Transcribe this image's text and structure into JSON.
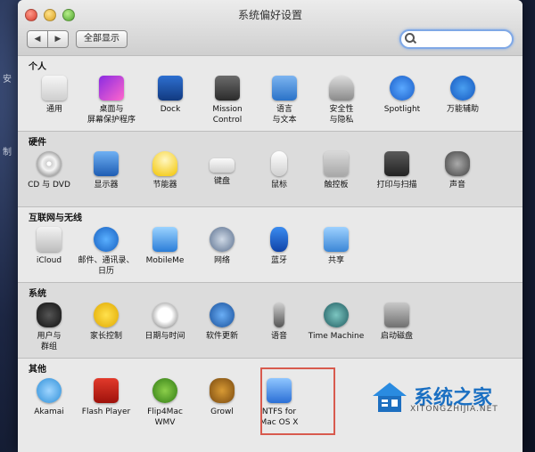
{
  "desktop": {
    "side_texts": [
      "安",
      "制"
    ]
  },
  "window": {
    "title": "系统偏好设置",
    "back_label": "◀",
    "forward_label": "▶",
    "show_all_label": "全部显示",
    "search_placeholder": ""
  },
  "sections": [
    {
      "title": "个人",
      "items": [
        {
          "label": "通用",
          "icon": "general-icon"
        },
        {
          "label": "桌面与\n屏幕保护程序",
          "icon": "desktop-icon"
        },
        {
          "label": "Dock",
          "icon": "dock-icon"
        },
        {
          "label": "Mission\nControl",
          "icon": "mission-control-icon"
        },
        {
          "label": "语言\n与文本",
          "icon": "language-icon"
        },
        {
          "label": "安全性\n与隐私",
          "icon": "security-icon"
        },
        {
          "label": "Spotlight",
          "icon": "spotlight-icon"
        },
        {
          "label": "万能辅助",
          "icon": "accessibility-icon"
        }
      ]
    },
    {
      "title": "硬件",
      "items": [
        {
          "label": "CD 与 DVD",
          "icon": "cd-icon"
        },
        {
          "label": "显示器",
          "icon": "display-icon"
        },
        {
          "label": "节能器",
          "icon": "energy-icon"
        },
        {
          "label": "键盘",
          "icon": "keyboard-icon"
        },
        {
          "label": "鼠标",
          "icon": "mouse-icon"
        },
        {
          "label": "触控板",
          "icon": "trackpad-icon"
        },
        {
          "label": "打印与扫描",
          "icon": "printer-icon"
        },
        {
          "label": "声音",
          "icon": "sound-icon"
        }
      ]
    },
    {
      "title": "互联网与无线",
      "items": [
        {
          "label": "iCloud",
          "icon": "icloud-icon"
        },
        {
          "label": "邮件、通讯录、\n日历",
          "icon": "mail-icon"
        },
        {
          "label": "MobileMe",
          "icon": "mobileme-icon"
        },
        {
          "label": "网络",
          "icon": "network-icon"
        },
        {
          "label": "蓝牙",
          "icon": "bluetooth-icon"
        },
        {
          "label": "共享",
          "icon": "sharing-icon"
        }
      ]
    },
    {
      "title": "系统",
      "items": [
        {
          "label": "用户与\n群组",
          "icon": "users-icon"
        },
        {
          "label": "家长控制",
          "icon": "parental-icon"
        },
        {
          "label": "日期与时间",
          "icon": "datetime-icon"
        },
        {
          "label": "软件更新",
          "icon": "update-icon"
        },
        {
          "label": "语音",
          "icon": "speech-icon"
        },
        {
          "label": "Time Machine",
          "icon": "timemachine-icon"
        },
        {
          "label": "启动磁盘",
          "icon": "startup-disk-icon"
        }
      ]
    },
    {
      "title": "其他",
      "items": [
        {
          "label": "Akamai",
          "icon": "akamai-icon"
        },
        {
          "label": "Flash Player",
          "icon": "flash-icon"
        },
        {
          "label": "Flip4Mac\nWMV",
          "icon": "wmv-icon"
        },
        {
          "label": "Growl",
          "icon": "growl-icon"
        },
        {
          "label": "NTFS for\nMac OS X",
          "icon": "ntfs-icon"
        }
      ]
    }
  ],
  "watermark": {
    "name": "系统之家",
    "url": "XITONGZHIJIA.NET"
  }
}
